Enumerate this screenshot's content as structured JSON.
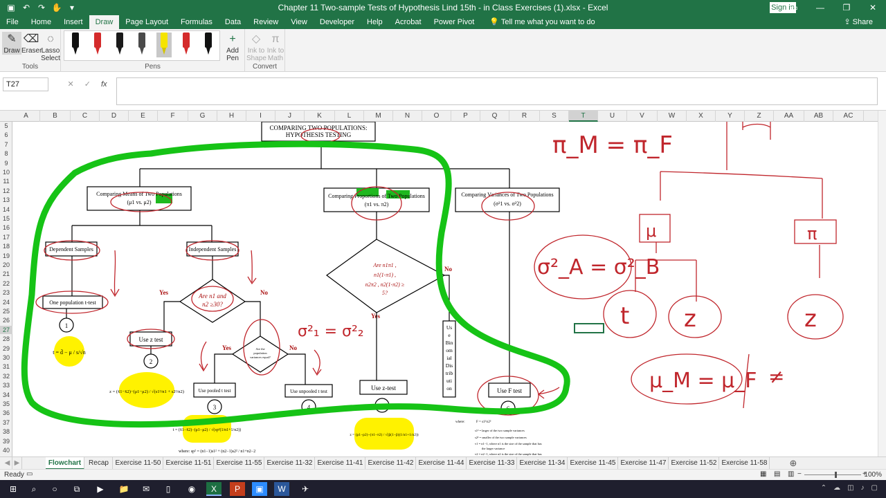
{
  "window": {
    "title": "Chapter 11 Two-sample Tests of Hypothesis Lind 15th - in Class Exercises (1).xlsx  -  Excel",
    "signin_label": "Sign in"
  },
  "ribbon": {
    "tabs": [
      "File",
      "Home",
      "Insert",
      "Draw",
      "Page Layout",
      "Formulas",
      "Data",
      "Review",
      "View",
      "Developer",
      "Help",
      "Acrobat",
      "Power Pivot"
    ],
    "tell_me": "Tell me what you want to do",
    "share": "Share",
    "groups": {
      "tools": {
        "label": "Tools",
        "draw": "Draw",
        "eraser": "Eraser",
        "lasso": "Lasso Select"
      },
      "pens": {
        "label": "Pens",
        "add_pen": "Add Pen"
      },
      "convert": {
        "label": "Convert",
        "ink_to_shape": "Ink to Shape",
        "ink_to_math": "Ink to Math"
      }
    },
    "pen_colors": [
      "#111111",
      "#d42b2b",
      "#1a1a1a",
      "#4a4a4a",
      "#f5e400",
      "#d42b2b",
      "#111111"
    ]
  },
  "formula_bar": {
    "name_box": "T27",
    "fx": "fx",
    "value": ""
  },
  "columns": [
    "A",
    "B",
    "C",
    "D",
    "E",
    "F",
    "G",
    "H",
    "I",
    "J",
    "K",
    "L",
    "M",
    "N",
    "O",
    "P",
    "Q",
    "R",
    "S",
    "T",
    "U",
    "V",
    "W",
    "X",
    "Y",
    "Z",
    "AA",
    "AB",
    "AC"
  ],
  "selected_column": "T",
  "rows": [
    "5",
    "6",
    "7",
    "8",
    "9",
    "10",
    "11",
    "12",
    "13",
    "14",
    "15",
    "16",
    "17",
    "18",
    "19",
    "20",
    "21",
    "22",
    "23",
    "24",
    "25",
    "26",
    "27",
    "28",
    "29",
    "30",
    "31",
    "32",
    "33",
    "34",
    "35",
    "36",
    "37",
    "38",
    "39",
    "40"
  ],
  "selected_row": "27",
  "flowchart": {
    "title_line1": "COMPARING TWO POPULATIONS:",
    "title_line2": "HYPOTHESIS TESTING",
    "means_line1": "Comparing Means of Two Populations",
    "means_line2": "(μ1 vs. μ2)",
    "props_line1": "Comparing Proportions of Two Populations",
    "props_line2": "(π1 vs. π2)",
    "vars_line1": "Comparing Variances of Two Populations",
    "vars_line2": "(σ²1 vs. σ²2)",
    "dependent": "Dependent Samples",
    "independent": "Independent Samples",
    "one_pop_t": "One population t-test",
    "diamond1_line1": "Are n1 and",
    "diamond1_line2": "n2 ≥30?",
    "yes": "Yes",
    "no": "No",
    "use_z": "Use z test",
    "diamond2_line1": "Are the",
    "diamond2_line2": "population",
    "diamond2_line3": "variances equal?",
    "use_pooled": "Use pooled t test",
    "use_unpooled": "Use unpooled t test",
    "diamond3_line1": "Are n1π1 ,",
    "diamond3_line2": "n1(1-π1) ,",
    "diamond3_line3": "n2π2 , n2(1-π2) ≥",
    "diamond3_line4": "5?",
    "binomial": [
      "Us",
      "e",
      "Bin",
      "om",
      "ial",
      "Dis",
      "trib",
      "uti",
      "on"
    ],
    "use_ztest": "Use z-test",
    "use_f": "Use F test",
    "circles": [
      "1",
      "2",
      "3",
      "4",
      "5",
      "6"
    ],
    "formula1": "t = d̄ − μ / s/√n",
    "formula2": "z = (x̄1−x̄2)−(μ1−μ2) / √(s1²/n1 + s2²/n2)",
    "formula3": "t = (x̄1−x̄2)−(μ1−μ2) / √(sp²(1/n1+1/n2))",
    "formula5": "z = (p1−p2)−(π1−π2) / √(p̄(1−p̄)(1/n1+1/n2))",
    "where_pooled": "where:  sp² = (n1−1)s1² + (n2−1)s2² / n1+n2−2",
    "where_f": "where:",
    "f_eq": "F = s1²/s2²",
    "f_note1": "s1² = larger of the two sample variances",
    "f_note2": "s2² = smaller of the two sample variances",
    "f_note3": "v1 = n1−1, where n1 is the size of the sample that has",
    "f_note4": "the larger variance",
    "f_note5": "v2 = n2−1, where n2 is the size of the sample that has"
  },
  "handwriting": {
    "pi_eq": "π_M = π_F",
    "sigma_eq": "σ²_A = σ²_B",
    "mu_eq": "μ_M = μ_F",
    "neq": "≠",
    "mu": "μ",
    "pi": "π",
    "t": "t",
    "z": "z",
    "z2": "z",
    "z3": "z",
    "sigma_mid": "σ²₁ = σ²₂"
  },
  "sheets": [
    "Flowchart",
    "Recap",
    "Exercise 11-50",
    "Exercise 11-51",
    "Exercise 11-55",
    "Exercise 11-32",
    "Exercise 11-41",
    "Exercise 11-42",
    "Exercise 11-44",
    "Exercise 11-33",
    "Exercise 11-34",
    "Exercise 11-45",
    "Exercise 11-47",
    "Exercise 11-52",
    "Exercise 11-58"
  ],
  "active_sheet": "Flowchart",
  "status": {
    "ready": "Ready",
    "zoom": "100%"
  }
}
